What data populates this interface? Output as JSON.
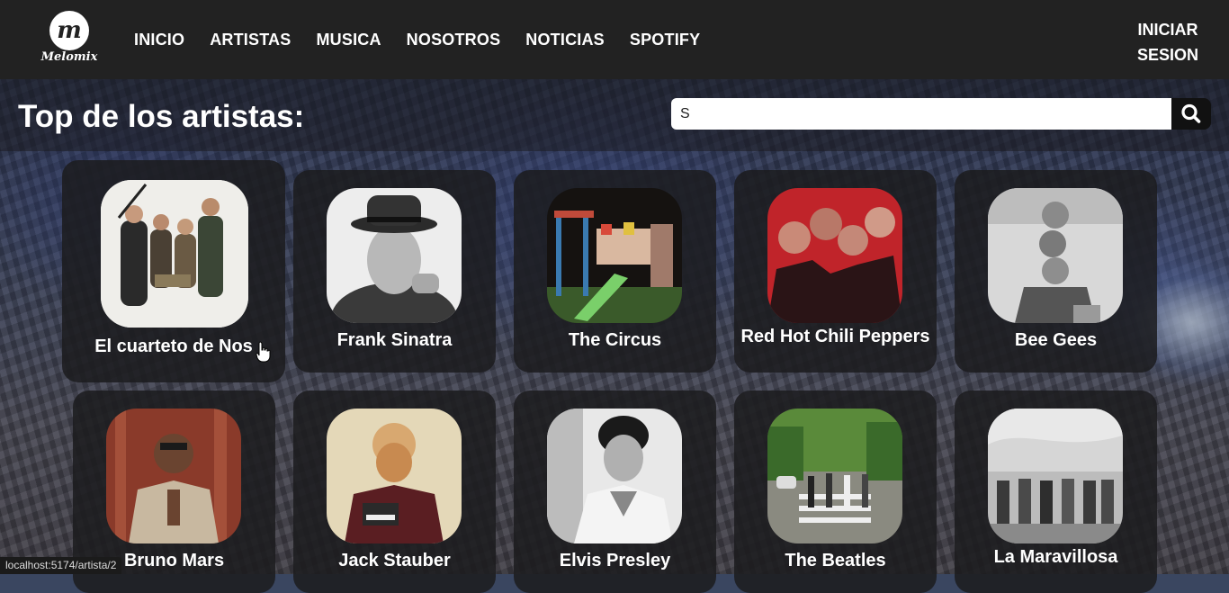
{
  "brand": {
    "logo_letter": "m",
    "name": "Melomix"
  },
  "nav": {
    "items": [
      "INICIO",
      "ARTISTAS",
      "MUSICA",
      "NOSOTROS",
      "NOTICIAS",
      "SPOTIFY"
    ],
    "login_line1": "INICIAR",
    "login_line2": "SESION"
  },
  "page": {
    "title": "Top de los artistas:"
  },
  "search": {
    "value": "S",
    "placeholder": ""
  },
  "icons": {
    "search": "search-icon",
    "logo": "melomix-logo-icon",
    "cursor": "hand-pointer-icon"
  },
  "artists": [
    {
      "name": "El cuarteto de Nos"
    },
    {
      "name": "Frank Sinatra"
    },
    {
      "name": "The Circus"
    },
    {
      "name": "Red Hot Chili Peppers"
    },
    {
      "name": "Bee Gees"
    },
    {
      "name": "Bruno Mars"
    },
    {
      "name": "Jack Stauber"
    },
    {
      "name": "Elvis Presley"
    },
    {
      "name": "The Beatles"
    },
    {
      "name": "La Maravillosa"
    }
  ],
  "status": {
    "url": "localhost:5174/artista/2"
  },
  "colors": {
    "header": "#222222",
    "card": "#1c1c1e",
    "accent": "#ffffff"
  }
}
